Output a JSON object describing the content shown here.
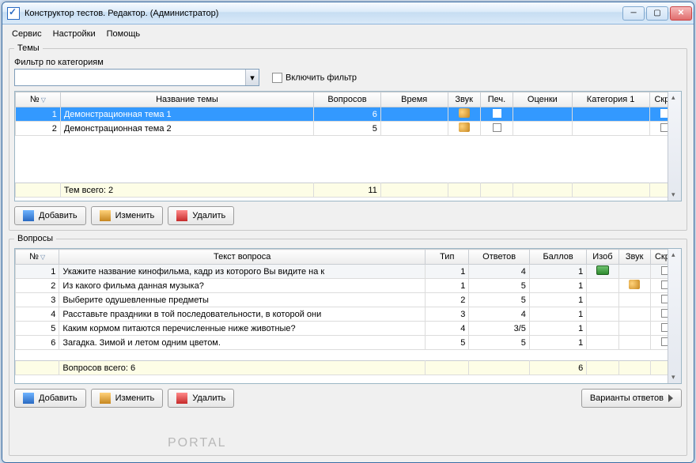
{
  "window": {
    "title": "Конструктор тестов. Редактор.  (Администратор)"
  },
  "menu": {
    "service": "Сервис",
    "settings": "Настройки",
    "help": "Помощь"
  },
  "topics": {
    "legend": "Темы",
    "filter_label": "Фильтр по категориям",
    "enable_filter": "Включить фильтр",
    "headers": {
      "num": "№",
      "name": "Название темы",
      "questions": "Вопросов",
      "time": "Время",
      "sound": "Звук",
      "print": "Печ.",
      "grades": "Оценки",
      "cat1": "Категория 1",
      "hidden": "Скры"
    },
    "rows": [
      {
        "num": "1",
        "name": "Демонстрационная тема 1",
        "questions": "6",
        "time": "",
        "print": false,
        "hidden": false,
        "selected": true,
        "sound": true
      },
      {
        "num": "2",
        "name": "Демонстрационная тема 2",
        "questions": "5",
        "time": "",
        "print": false,
        "hidden": false,
        "selected": false,
        "sound": true
      }
    ],
    "summary": {
      "label": "Тем всего: 2",
      "total": "11"
    }
  },
  "questions": {
    "legend": "Вопросы",
    "headers": {
      "num": "№",
      "text": "Текст вопроса",
      "type": "Тип",
      "answers": "Ответов",
      "points": "Баллов",
      "image": "Изоб",
      "sound": "Звук",
      "hidden": "Скры"
    },
    "rows": [
      {
        "num": "1",
        "text": "Укажите название кинофильма, кадр из которого Вы видите на к",
        "type": "1",
        "answers": "4",
        "points": "1",
        "image": true,
        "sound": false,
        "hidden": false,
        "sel": true
      },
      {
        "num": "2",
        "text": "Из какого фильма данная музыка?",
        "type": "1",
        "answers": "5",
        "points": "1",
        "image": false,
        "sound": true,
        "hidden": false
      },
      {
        "num": "3",
        "text": "Выберите одушевленные предметы",
        "type": "2",
        "answers": "5",
        "points": "1",
        "image": false,
        "sound": false,
        "hidden": false
      },
      {
        "num": "4",
        "text": "Расставьте праздники в той последовательности, в которой они",
        "type": "3",
        "answers": "4",
        "points": "1",
        "image": false,
        "sound": false,
        "hidden": false
      },
      {
        "num": "5",
        "text": "Каким кормом питаются перечисленные ниже животные?",
        "type": "4",
        "answers": "3/5",
        "points": "1",
        "image": false,
        "sound": false,
        "hidden": false
      },
      {
        "num": "6",
        "text": "Загадка. Зимой и летом одним цветом.",
        "type": "5",
        "answers": "5",
        "points": "1",
        "image": false,
        "sound": false,
        "hidden": false
      }
    ],
    "summary": {
      "label": "Вопросов всего: 6",
      "total": "6"
    }
  },
  "buttons": {
    "add": "Добавить",
    "edit": "Изменить",
    "delete": "Удалить",
    "variants": "Варианты ответов"
  },
  "watermark": "PORTAL"
}
